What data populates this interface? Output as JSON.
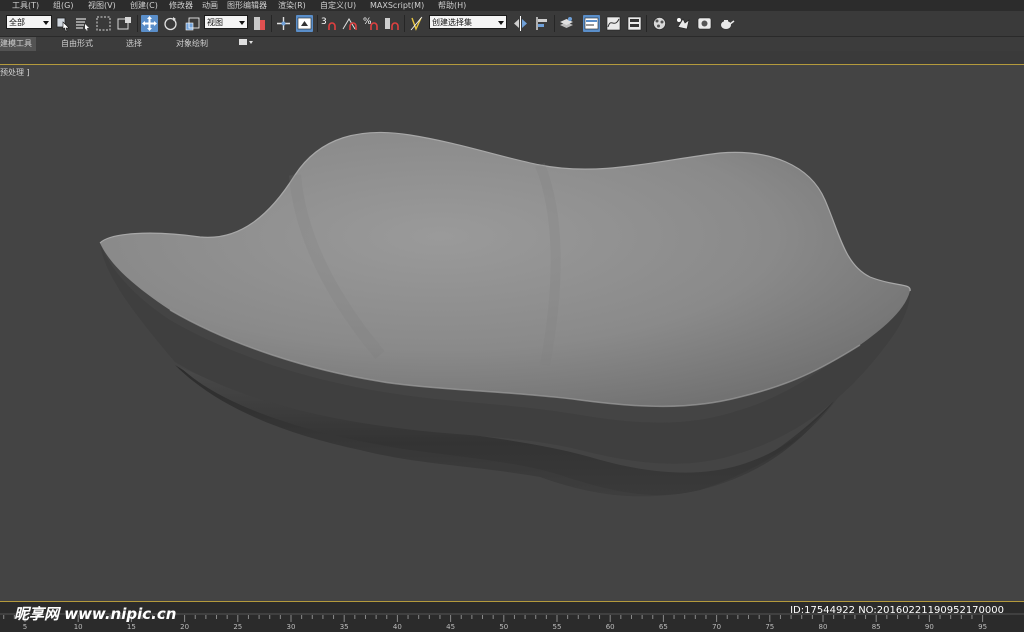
{
  "menu": [
    "工具(T)",
    "组(G)",
    "视图(V)",
    "创建(C)",
    "修改器",
    "动画",
    "图形编辑器",
    "渲染(R)",
    "自定义(U)",
    "MAXScript(M)",
    "帮助(H)"
  ],
  "toolbar": {
    "selection_filter": "全部",
    "reference_coord": "视图",
    "snap_labels": [
      "3",
      "%"
    ],
    "named_selection": "创建选择集"
  },
  "ribbon": {
    "tabs": [
      "建模工具",
      "自由形式",
      "选择",
      "对象绘制"
    ],
    "active_tab": "建模工具"
  },
  "viewport": {
    "label": "预处理 ]",
    "bowl_color": "#8a8a8a"
  },
  "timeline": {
    "ticks": [
      "5",
      "10",
      "15",
      "20",
      "25",
      "30",
      "35",
      "40",
      "45",
      "50",
      "55",
      "60",
      "65",
      "70",
      "75",
      "80",
      "85",
      "90",
      "95"
    ]
  },
  "watermark": {
    "left": "昵享网 www.nipic.cn",
    "right": "ID:17544922 NO:20160221190952170000"
  },
  "colors": {
    "accent": "#5a8ec9",
    "viewport_border": "#b49a3c",
    "background": "#444444"
  }
}
